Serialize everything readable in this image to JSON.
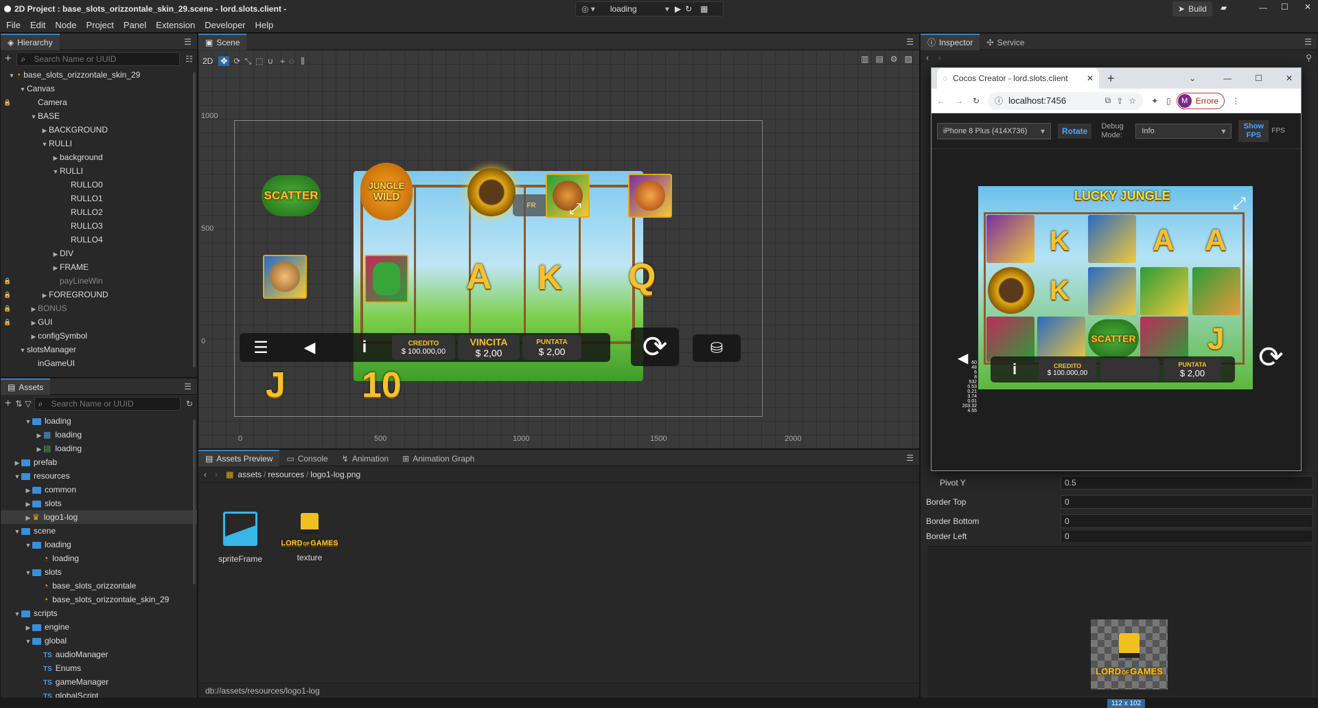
{
  "title": "2D Project : base_slots_orizzontale_skin_29.scene - lord.slots.client -",
  "menu": [
    "File",
    "Edit",
    "Node",
    "Project",
    "Panel",
    "Extension",
    "Developer",
    "Help"
  ],
  "toolbar": {
    "scene_select": "loading",
    "build": "Build"
  },
  "hierarchy": {
    "tab": "Hierarchy",
    "search_placeholder": "Search Name or UUID",
    "items": [
      {
        "label": "base_slots_orizzontale_skin_29",
        "d": 0,
        "a": "down",
        "lock": false,
        "dim": false
      },
      {
        "label": "Canvas",
        "d": 1,
        "a": "down",
        "lock": false,
        "dim": false
      },
      {
        "label": "Camera",
        "d": 2,
        "a": "",
        "lock": true,
        "dim": false
      },
      {
        "label": "BASE",
        "d": 2,
        "a": "down",
        "lock": false,
        "dim": false
      },
      {
        "label": "BACKGROUND",
        "d": 3,
        "a": "right",
        "lock": false,
        "dim": false
      },
      {
        "label": "RULLI",
        "d": 3,
        "a": "down",
        "lock": false,
        "dim": false
      },
      {
        "label": "background",
        "d": 4,
        "a": "right",
        "lock": false,
        "dim": false
      },
      {
        "label": "RULLI",
        "d": 4,
        "a": "down",
        "lock": false,
        "dim": false
      },
      {
        "label": "RULLO0",
        "d": 5,
        "a": "",
        "lock": false,
        "dim": false
      },
      {
        "label": "RULLO1",
        "d": 5,
        "a": "",
        "lock": false,
        "dim": false
      },
      {
        "label": "RULLO2",
        "d": 5,
        "a": "",
        "lock": false,
        "dim": false
      },
      {
        "label": "RULLO3",
        "d": 5,
        "a": "",
        "lock": false,
        "dim": false
      },
      {
        "label": "RULLO4",
        "d": 5,
        "a": "",
        "lock": false,
        "dim": false
      },
      {
        "label": "DIV",
        "d": 4,
        "a": "right",
        "lock": false,
        "dim": false
      },
      {
        "label": "FRAME",
        "d": 4,
        "a": "right",
        "lock": false,
        "dim": false
      },
      {
        "label": "payLineWin",
        "d": 4,
        "a": "",
        "lock": true,
        "dim": true
      },
      {
        "label": "FOREGROUND",
        "d": 3,
        "a": "right",
        "lock": true,
        "dim": false
      },
      {
        "label": "BONUS",
        "d": 2,
        "a": "right",
        "lock": true,
        "dim": true
      },
      {
        "label": "GUI",
        "d": 2,
        "a": "right",
        "lock": true,
        "dim": false
      },
      {
        "label": "configSymbol",
        "d": 2,
        "a": "right",
        "lock": false,
        "dim": false
      },
      {
        "label": "slotsManager",
        "d": 1,
        "a": "down",
        "lock": false,
        "dim": false
      },
      {
        "label": "inGameUI",
        "d": 2,
        "a": "",
        "lock": false,
        "dim": false
      }
    ]
  },
  "assets": {
    "tab": "Assets",
    "search_placeholder": "Search Name or UUID",
    "items": [
      {
        "label": "loading",
        "d": 1,
        "a": "down",
        "k": "folder",
        "sel": false
      },
      {
        "label": "loading",
        "d": 2,
        "a": "right",
        "k": "scene-asset",
        "sel": false
      },
      {
        "label": "loading",
        "d": 2,
        "a": "right",
        "k": "script-asset",
        "sel": false
      },
      {
        "label": "prefab",
        "d": 0,
        "a": "right",
        "k": "folder",
        "sel": false
      },
      {
        "label": "resources",
        "d": 0,
        "a": "down",
        "k": "folder",
        "sel": false
      },
      {
        "label": "common",
        "d": 1,
        "a": "right",
        "k": "folder",
        "sel": false
      },
      {
        "label": "slots",
        "d": 1,
        "a": "right",
        "k": "folder",
        "sel": false
      },
      {
        "label": "logo1-log",
        "d": 1,
        "a": "right",
        "k": "image",
        "sel": true
      },
      {
        "label": "scene",
        "d": 0,
        "a": "down",
        "k": "folder",
        "sel": false
      },
      {
        "label": "loading",
        "d": 1,
        "a": "down",
        "k": "folder",
        "sel": false
      },
      {
        "label": "loading",
        "d": 2,
        "a": "",
        "k": "fire",
        "sel": false
      },
      {
        "label": "slots",
        "d": 1,
        "a": "down",
        "k": "folder",
        "sel": false
      },
      {
        "label": "base_slots_orizzontale",
        "d": 2,
        "a": "",
        "k": "fire",
        "sel": false
      },
      {
        "label": "base_slots_orizzontale_skin_29",
        "d": 2,
        "a": "",
        "k": "fire",
        "sel": false
      },
      {
        "label": "scripts",
        "d": 0,
        "a": "down",
        "k": "folder",
        "sel": false
      },
      {
        "label": "engine",
        "d": 1,
        "a": "right",
        "k": "folder",
        "sel": false
      },
      {
        "label": "global",
        "d": 1,
        "a": "down",
        "k": "folder",
        "sel": false
      },
      {
        "label": "audioManager",
        "d": 2,
        "a": "",
        "k": "ts",
        "sel": false
      },
      {
        "label": "Enums",
        "d": 2,
        "a": "",
        "k": "ts",
        "sel": false
      },
      {
        "label": "gameManager",
        "d": 2,
        "a": "",
        "k": "ts",
        "sel": false
      },
      {
        "label": "globalScript",
        "d": 2,
        "a": "",
        "k": "ts",
        "sel": false
      }
    ]
  },
  "scene": {
    "tab": "Scene",
    "mode2d": "2D",
    "axis_y": [
      "1000",
      "500",
      "0"
    ],
    "axis_x": [
      "0",
      "500",
      "1000",
      "1500",
      "2000"
    ],
    "symbols": {
      "scatter": "SCATTER",
      "wild_top": "JUNGLE",
      "wild_bottom": "WILD",
      "a": "A",
      "k": "K",
      "q": "Q",
      "j": "J",
      "ten": "10",
      "free": "FR"
    },
    "hud": {
      "credit_label": "CREDITO",
      "credit_value": "$ 100.000,00",
      "win_label": "VINCITA",
      "win_value": "$ 2,00",
      "bet_label": "PUNTATA",
      "bet_value": "$ 2,00",
      "info": "i"
    }
  },
  "bottom": {
    "tabs": [
      "Assets Preview",
      "Console",
      "Animation",
      "Animation Graph"
    ],
    "path_parts": [
      "assets",
      "resources",
      "logo1-log.png"
    ],
    "preview_items": [
      {
        "label": "spriteFrame"
      },
      {
        "label": "texture"
      }
    ],
    "logo_top": "LORD",
    "logo_of": "OF",
    "logo_bottom": "GAMES",
    "status": "db://assets/resources/logo1-log"
  },
  "inspector": {
    "tabs": [
      "Inspector",
      "Service"
    ],
    "fields": [
      {
        "label": "Pivot Y",
        "value": "0.5"
      },
      {
        "label": "Border Top",
        "value": "0"
      },
      {
        "label": "Border Bottom",
        "value": "0"
      },
      {
        "label": "Border Left",
        "value": "0"
      }
    ],
    "preview_size": "112 x 102"
  },
  "browser": {
    "tab_title": "Cocos Creator - lord.slots.client",
    "url": "localhost:7456",
    "profile_initial": "M",
    "profile_status": "Errore",
    "device": "iPhone 8 Plus (414X736)",
    "rotate": "Rotate",
    "debug_mode_label": "Debug Mode:",
    "debug_mode_value": "Info",
    "show_fps": "Show FPS",
    "fps_short": "FPS",
    "fps_value": "60",
    "game": {
      "title": "LUCKY JUNGLE",
      "scatter": "SCATTER",
      "credit_label": "CREDITO",
      "credit_value": "$ 100.000,00",
      "bet_label": "PUNTATA",
      "bet_value": "$ 2,00",
      "stats": [
        "60",
        "48",
        "6",
        "8",
        "532",
        "0.53",
        "0.21",
        "3.74",
        "0.01",
        "203.32",
        "4.55"
      ]
    }
  }
}
